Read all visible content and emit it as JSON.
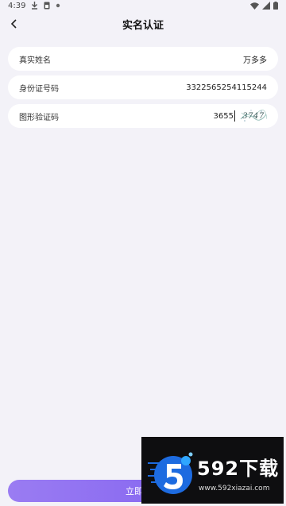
{
  "status_bar": {
    "time": "4:39"
  },
  "header": {
    "title": "实名认证"
  },
  "form": {
    "name": {
      "label": "真实姓名",
      "value": "万多多"
    },
    "id_number": {
      "label": "身份证号码",
      "value": "3322565254115244"
    },
    "captcha": {
      "label": "图形验证码",
      "value": "3655",
      "image_text": "3747"
    }
  },
  "submit": {
    "label": "立即认证"
  },
  "watermark": {
    "brand": "592下载",
    "url": "www.592xiazai.com"
  },
  "colors": {
    "background": "#f3f2f8",
    "accent": "#8a6cf1"
  }
}
